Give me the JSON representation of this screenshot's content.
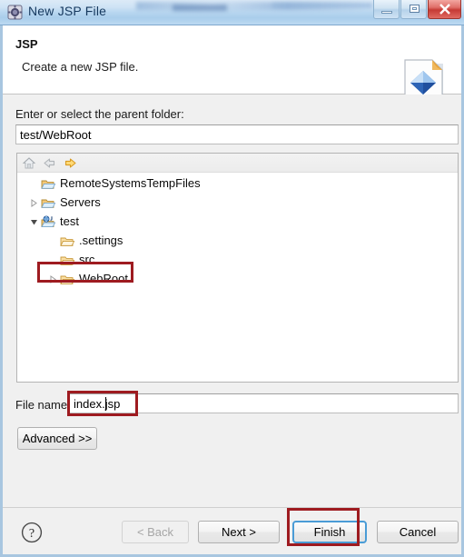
{
  "window": {
    "title": "New JSP File",
    "app_icon": "jsp-wizard-icon",
    "minimize_label": "Minimize",
    "maximize_label": "Maximize",
    "close_label": "Close"
  },
  "header": {
    "title": "JSP",
    "subtitle": "Create a new JSP file.",
    "icon": "jsp-file-banner-icon"
  },
  "form": {
    "parent_folder_label": "Enter or select the parent folder:",
    "parent_folder_value": "test/WebRoot",
    "parent_folder_placeholder": "",
    "file_name_label": "File name",
    "file_name_value": "index.jsp",
    "file_name_placeholder": "",
    "advanced_label": "Advanced >>"
  },
  "tree_toolbar": {
    "home_icon": "home-icon",
    "back_icon": "arrow-left-icon",
    "forward_icon": "arrow-right-icon"
  },
  "tree": {
    "items": [
      {
        "label": "RemoteSystemsTempFiles",
        "indent": 26,
        "icon": "folder-open-blue-icon",
        "twisty": "none",
        "selected": false
      },
      {
        "label": "Servers",
        "indent": 26,
        "icon": "folder-open-blue-icon",
        "twisty": "collapsed",
        "selected": false
      },
      {
        "label": "test",
        "indent": 26,
        "icon": "web-project-icon",
        "twisty": "expanded",
        "selected": false
      },
      {
        "label": ".settings",
        "indent": 47,
        "icon": "folder-open-tan-icon",
        "twisty": "none",
        "selected": false
      },
      {
        "label": "src",
        "indent": 47,
        "icon": "folder-open-tan-icon",
        "twisty": "none",
        "selected": false
      },
      {
        "label": "WebRoot",
        "indent": 47,
        "icon": "folder-open-tan-icon",
        "twisty": "collapsed",
        "selected": true
      }
    ]
  },
  "footer": {
    "help_icon": "help-question-icon",
    "back_label": "< Back",
    "next_label": "Next >",
    "finish_label": "Finish",
    "cancel_label": "Cancel"
  },
  "annotations": {
    "color": "#9e1b20",
    "boxes": [
      "webroot-tree-item",
      "file-name-input",
      "finish-button"
    ]
  },
  "colors": {
    "titlebar_start": "#dceaf7",
    "titlebar_end": "#bcd9f1",
    "dialog_bg": "#f0f0f0",
    "focus_ring": "#4a9cd6",
    "annotation_red": "#9e1b20",
    "close_button": "#c63a34"
  }
}
